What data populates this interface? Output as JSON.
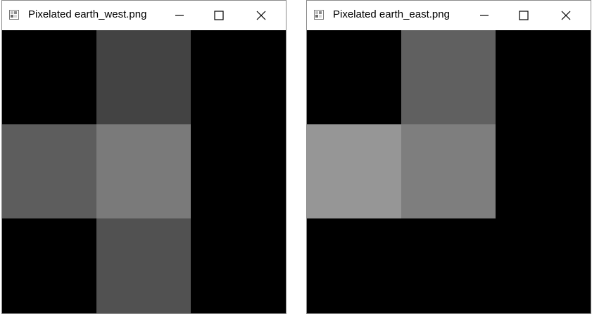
{
  "windows": [
    {
      "id": "west",
      "title": "Pixelated earth_west.png",
      "controls": {
        "minimize_icon": "minimize-icon",
        "maximize_icon": "maximize-icon",
        "close_icon": "close-icon"
      },
      "grid": {
        "rows": 3,
        "cols": 3,
        "cells": [
          [
            "#000000",
            "#434343",
            "#000000"
          ],
          [
            "#5d5d5d",
            "#7a7a7a",
            "#000000"
          ],
          [
            "#000000",
            "#515151",
            "#000000"
          ]
        ]
      }
    },
    {
      "id": "east",
      "title": "Pixelated earth_east.png",
      "controls": {
        "minimize_icon": "minimize-icon",
        "maximize_icon": "maximize-icon",
        "close_icon": "close-icon"
      },
      "grid": {
        "rows": 3,
        "cols": 3,
        "cells": [
          [
            "#000000",
            "#606060",
            "#000000"
          ],
          [
            "#969696",
            "#7e7e7e",
            "#000000"
          ],
          [
            "#000000",
            "#000000",
            "#000000"
          ]
        ]
      }
    }
  ]
}
